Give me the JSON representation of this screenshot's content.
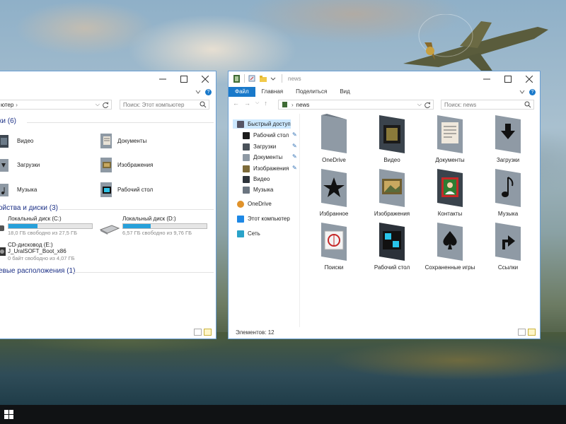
{
  "left_window": {
    "breadcrumb": "ютер",
    "search_placeholder": "Поиск: Этот компьютер",
    "groups": [
      {
        "title": "ки (6)"
      },
      {
        "title": "ойства и диски (3)"
      },
      {
        "title": "евые расположения (1)"
      }
    ],
    "folders": [
      {
        "label": "Видео",
        "icon": "video-folder-icon"
      },
      {
        "label": "Документы",
        "icon": "documents-folder-icon"
      },
      {
        "label": "Загрузки",
        "icon": "downloads-folder-icon"
      },
      {
        "label": "Изображения",
        "icon": "pictures-folder-icon"
      },
      {
        "label": "Музыка",
        "icon": "music-folder-icon"
      },
      {
        "label": "Рабочий стол",
        "icon": "desktop-folder-icon"
      }
    ],
    "drives": [
      {
        "name": "Локальный диск (C:)",
        "free": "18,0 ГБ свободно из 27,5 ГБ",
        "used_fraction": 0.35
      },
      {
        "name": "Локальный диск (D:)",
        "free": "6,57 ГБ свободно из 9,76 ГБ",
        "used_fraction": 0.33
      },
      {
        "name": "CD-дисковод (E:)",
        "label2": "J_UralSOFT_Boot_x86",
        "free": "0 байт свободно из 4,07 ГБ"
      }
    ]
  },
  "right_window": {
    "title": "news",
    "ribbon_tabs": [
      "Файл",
      "Главная",
      "Поделиться",
      "Вид"
    ],
    "address": "news",
    "search_placeholder": "Поиск: news",
    "nav": {
      "quick_access": "Быстрый доступ",
      "quick_items": [
        "Рабочий стол",
        "Загрузки",
        "Документы",
        "Изображения",
        "Видео",
        "Музыка"
      ],
      "onedrive": "OneDrive",
      "this_pc": "Этот компьютер",
      "network": "Сеть"
    },
    "items": [
      {
        "label": "OneDrive",
        "icon": "cloud"
      },
      {
        "label": "Видео",
        "icon": "film"
      },
      {
        "label": "Документы",
        "icon": "document"
      },
      {
        "label": "Загрузки",
        "icon": "download-arrow"
      },
      {
        "label": "Избранное",
        "icon": "star"
      },
      {
        "label": "Изображения",
        "icon": "picture"
      },
      {
        "label": "Контакты",
        "icon": "contact"
      },
      {
        "label": "Музыка",
        "icon": "music-note"
      },
      {
        "label": "Поиски",
        "icon": "search"
      },
      {
        "label": "Рабочий стол",
        "icon": "desktop"
      },
      {
        "label": "Сохраненные игры",
        "icon": "spade"
      },
      {
        "label": "Ссылки",
        "icon": "link-arrow"
      }
    ],
    "status": "Элементов: 12"
  }
}
